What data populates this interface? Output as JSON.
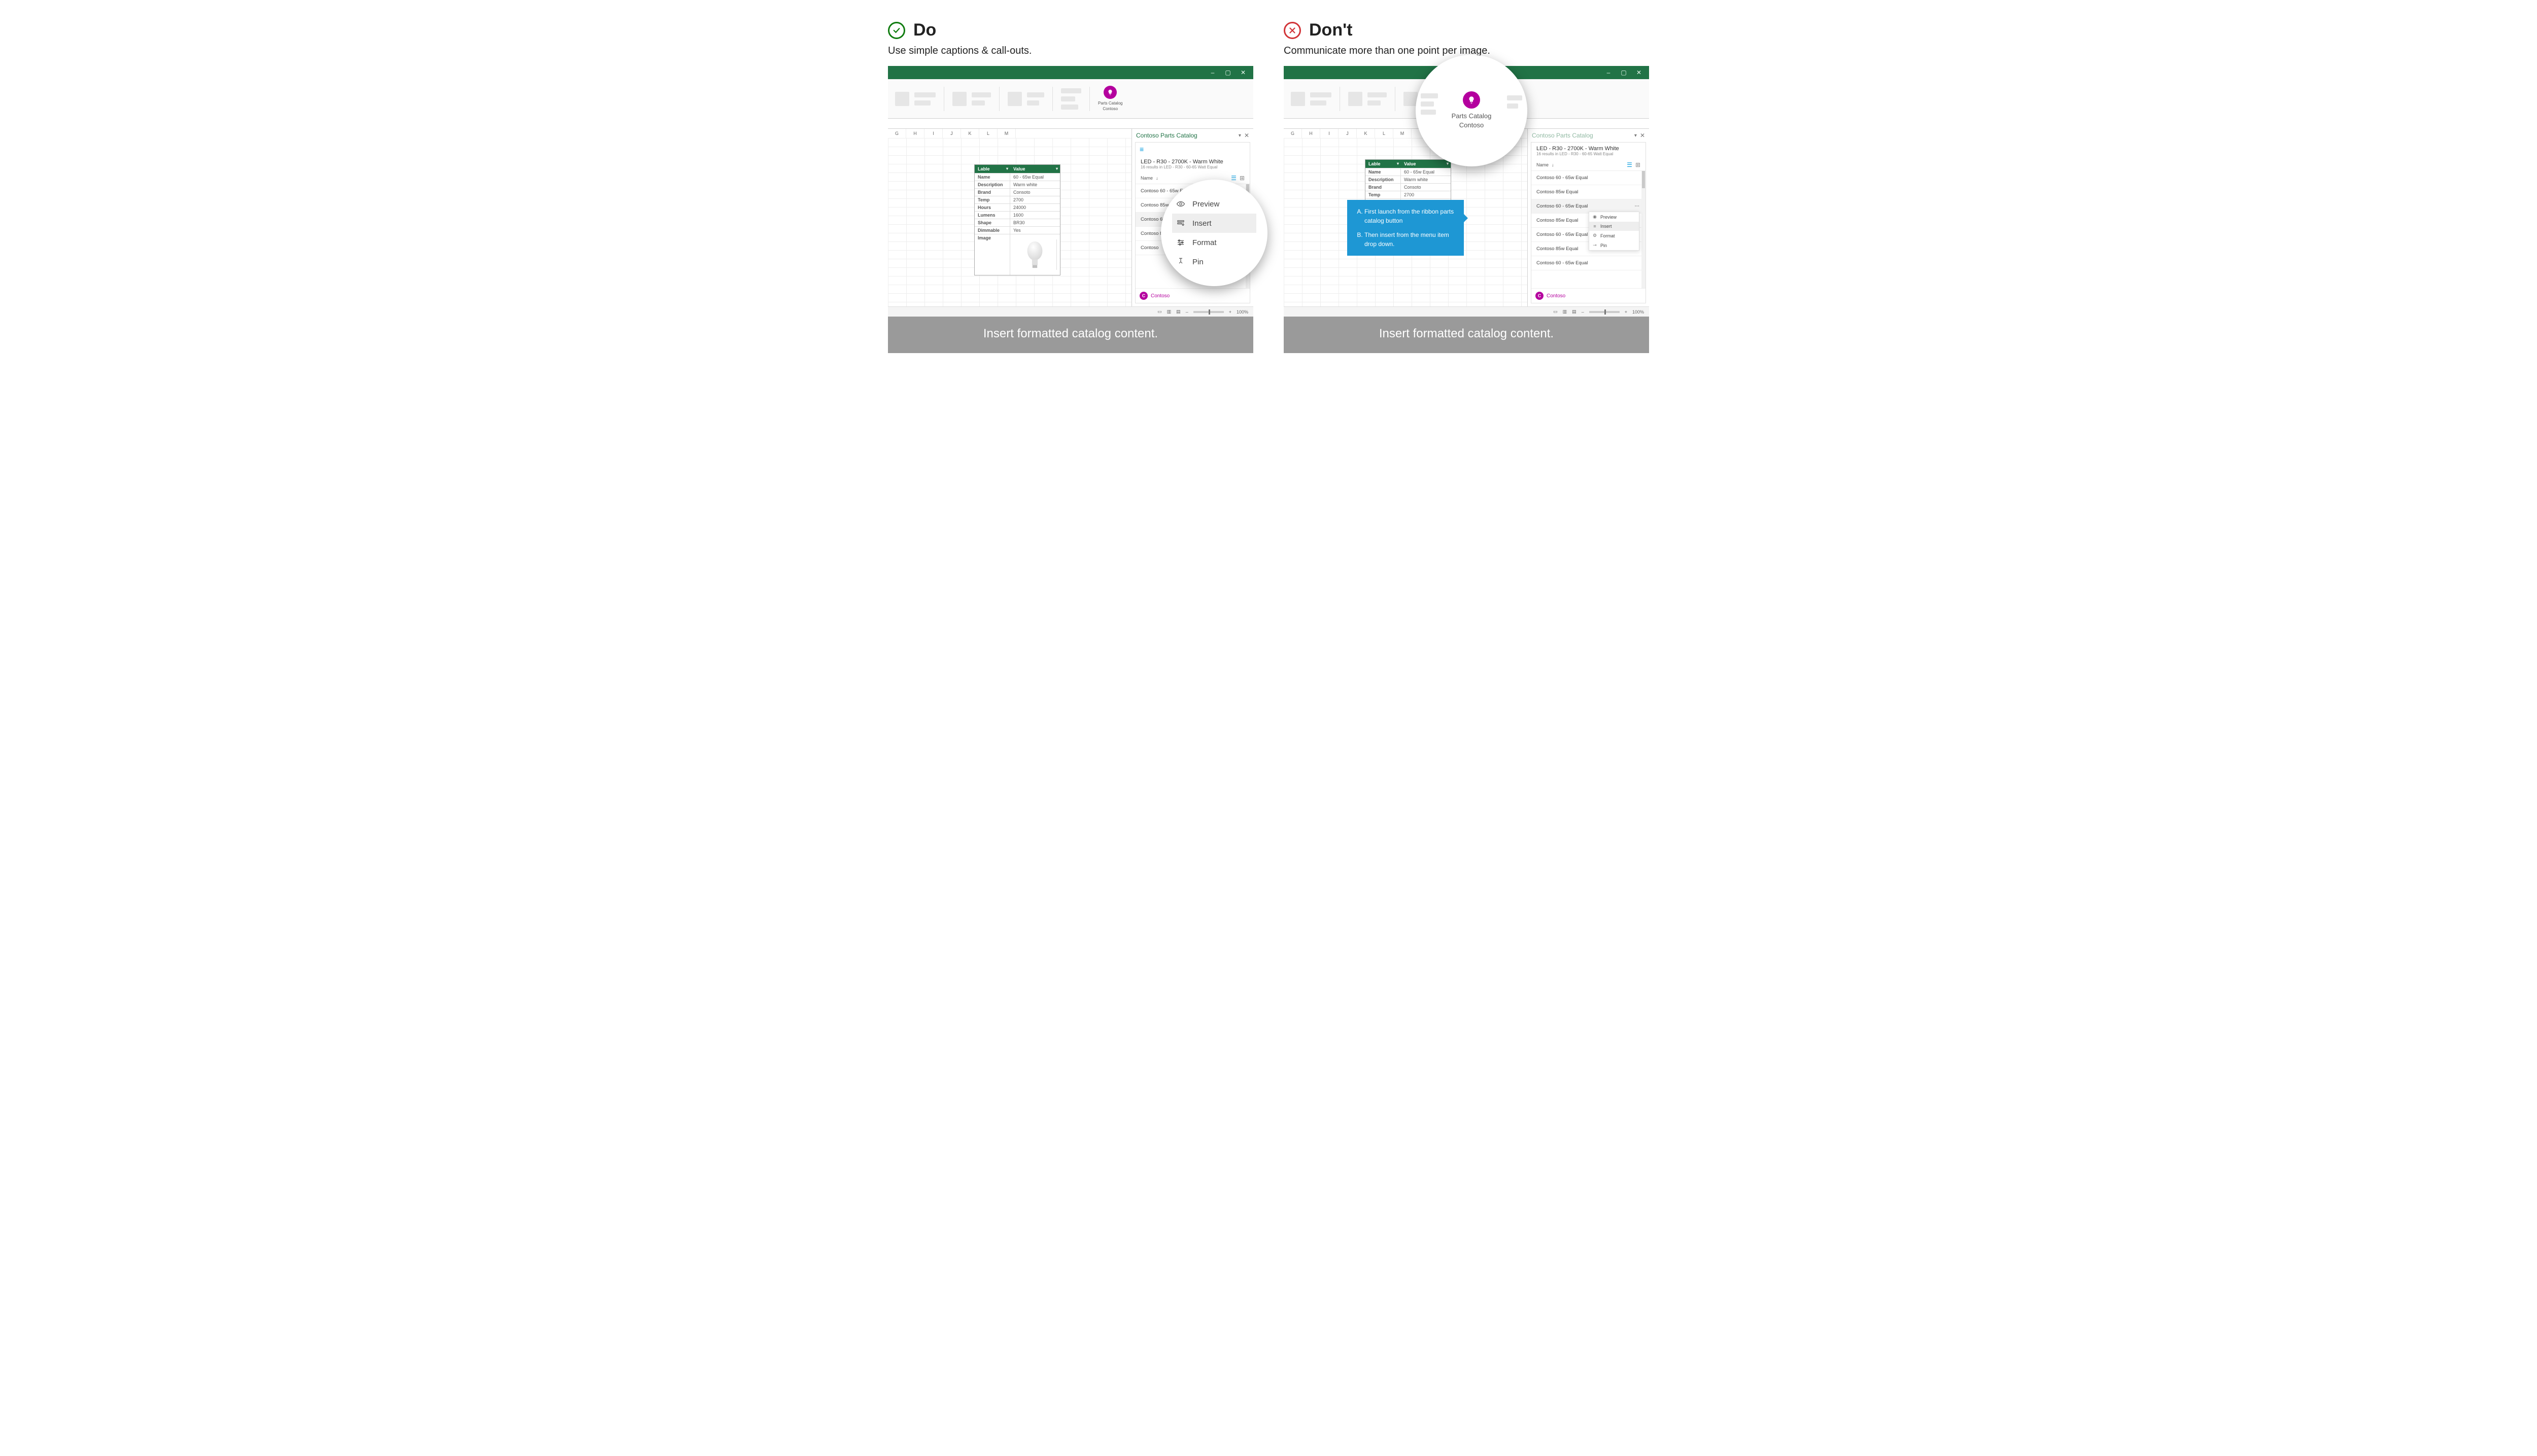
{
  "do": {
    "title": "Do",
    "subhead": "Use simple captions & call-outs.",
    "caption": "Insert formatted catalog content."
  },
  "dont": {
    "title": "Don't",
    "subhead": "Communicate more than one point per image.",
    "caption": "Insert formatted catalog content."
  },
  "ribbonAddin": {
    "line1": "Parts Catalog",
    "line2": "Contoso"
  },
  "taskpane": {
    "title": "Contoso Parts Catalog",
    "searchTitle": "LED - R30 - 2700K - Warm White",
    "searchSub": "16 results in LED - R30 - 60-65 Watt Equal",
    "sortLabel": "Name",
    "items_do": [
      "Contoso 60 - 65w Equal",
      "Contoso 85w Equal",
      "Contoso 60 - 65w Equal",
      "Contoso 85w",
      "Contoso"
    ],
    "items_dont": [
      "Contoso 60 - 65w Equal",
      "Contoso 85w Equal",
      "Contoso 60 - 65w Equal",
      "Contoso 85w Equal",
      "Contoso 60 - 65w Equal",
      "Contoso 85w Equal",
      "Contoso 60 - 65w Equal"
    ],
    "footer": "Contoso"
  },
  "sheetCols": [
    "G",
    "H",
    "I",
    "J",
    "K",
    "L",
    "M"
  ],
  "table": {
    "head": [
      "Lable",
      "Value"
    ],
    "rows": [
      [
        "Name",
        "60 - 65w Equal"
      ],
      [
        "Description",
        "Warm white"
      ],
      [
        "Brand",
        "Consoto"
      ],
      [
        "Temp",
        "2700"
      ],
      [
        "Hours",
        "24000"
      ],
      [
        "Lumens",
        "1600"
      ],
      [
        "Shape",
        "BR30"
      ],
      [
        "Dimmable",
        "Yes"
      ],
      [
        "Image",
        ""
      ]
    ]
  },
  "menu": {
    "preview": "Preview",
    "insert": "Insert",
    "format": "Format",
    "pin": "Pin"
  },
  "callout": {
    "a": "First launch from the ribbon parts catalog button",
    "b": "Then insert from the menu item drop down."
  },
  "statusbar": {
    "zoom": "100%"
  }
}
